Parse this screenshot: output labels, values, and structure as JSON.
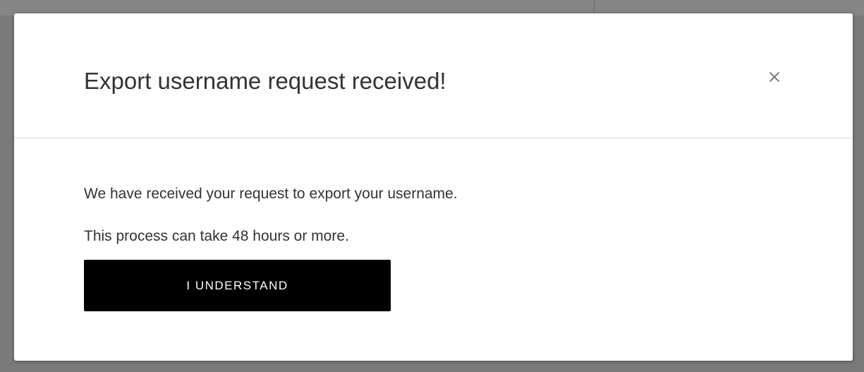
{
  "modal": {
    "title": "Export username request received!",
    "close_icon": "close-icon",
    "body_lines": [
      "We have received your request to export your username.",
      "This process can take 48 hours or more."
    ],
    "confirm_label": "I UNDERSTAND"
  },
  "colors": {
    "overlay": "#7a7a7a",
    "modal_background": "#ffffff",
    "text": "#333333",
    "button_background": "#000000",
    "button_text": "#ffffff"
  }
}
